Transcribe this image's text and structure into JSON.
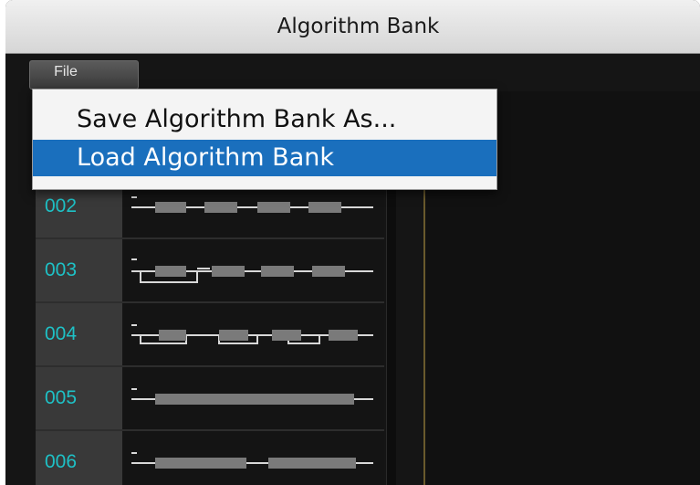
{
  "window": {
    "title": "Algorithm Bank"
  },
  "toolbar": {
    "file_label": "File"
  },
  "menu": {
    "items": [
      {
        "label": "Save Algorithm Bank As...",
        "selected": false
      },
      {
        "label": "Load Algorithm Bank",
        "selected": true
      }
    ]
  },
  "algorithms": [
    {
      "number": "002"
    },
    {
      "number": "003"
    },
    {
      "number": "004"
    },
    {
      "number": "005"
    },
    {
      "number": "006"
    }
  ],
  "colors": {
    "number_text": "#1ec1c6",
    "menu_highlight": "#1a6fbd",
    "divider": "#6a5a2c"
  }
}
